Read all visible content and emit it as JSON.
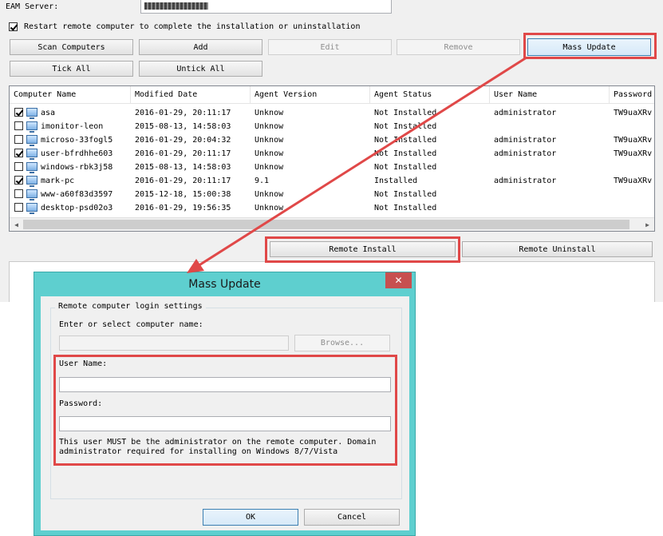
{
  "main": {
    "eam_server_label": "EAM Server:",
    "restart_label": "Restart remote computer to complete the installation or uninstallation",
    "restart_checked": true,
    "buttons": {
      "scan": "Scan Computers",
      "add": "Add",
      "edit": "Edit",
      "remove": "Remove",
      "mass_update": "Mass Update",
      "tick_all": "Tick All",
      "untick_all": "Untick All",
      "remote_install": "Remote Install",
      "remote_uninstall": "Remote Uninstall"
    },
    "columns": [
      "Computer Name",
      "Modified Date",
      "Agent Version",
      "Agent Status",
      "User Name",
      "Password"
    ],
    "rows": [
      {
        "checked": true,
        "name": "asa",
        "date": "2016-01-29, 20:11:17",
        "version": "Unknow",
        "status": "Not Installed",
        "user": "administrator",
        "password": "TW9uaXRv"
      },
      {
        "checked": false,
        "name": "imonitor-leon",
        "date": "2015-08-13, 14:58:03",
        "version": "Unknow",
        "status": "Not Installed",
        "user": "",
        "password": ""
      },
      {
        "checked": false,
        "name": "microso-33fogl5",
        "date": "2016-01-29, 20:04:32",
        "version": "Unknow",
        "status": "Not Installed",
        "user": "administrator",
        "password": "TW9uaXRv"
      },
      {
        "checked": true,
        "name": "user-bfrdhhe603",
        "date": "2016-01-29, 20:11:17",
        "version": "Unknow",
        "status": "Not Installed",
        "user": "administrator",
        "password": "TW9uaXRv"
      },
      {
        "checked": false,
        "name": "windows-rbk3j58",
        "date": "2015-08-13, 14:58:03",
        "version": "Unknow",
        "status": "Not Installed",
        "user": "",
        "password": ""
      },
      {
        "checked": true,
        "name": "mark-pc",
        "date": "2016-01-29, 20:11:17",
        "version": "9.1",
        "status": "Installed",
        "user": "administrator",
        "password": "TW9uaXRv"
      },
      {
        "checked": false,
        "name": "www-a60f83d3597",
        "date": "2015-12-18, 15:00:38",
        "version": "Unknow",
        "status": "Not Installed",
        "user": "",
        "password": ""
      },
      {
        "checked": false,
        "name": "desktop-psd02o3",
        "date": "2016-01-29, 19:56:35",
        "version": "Unknow",
        "status": "Not Installed",
        "user": "",
        "password": ""
      }
    ]
  },
  "dialog": {
    "title": "Mass Update",
    "close_glyph": "✕",
    "group_label": "Remote computer login settings",
    "computer_label": "Enter or select computer name:",
    "browse": "Browse...",
    "user_label": "User Name:",
    "user_value": "",
    "password_label": "Password:",
    "password_value": "",
    "note_line1": "This user MUST be the administrator on the remote computer. Domain",
    "note_line2": "administrator required for installing on Windows 8/7/Vista",
    "ok": "OK",
    "cancel": "Cancel"
  },
  "colors": {
    "annotation_red": "#e04848",
    "dialog_frame": "#5ecfcf"
  }
}
